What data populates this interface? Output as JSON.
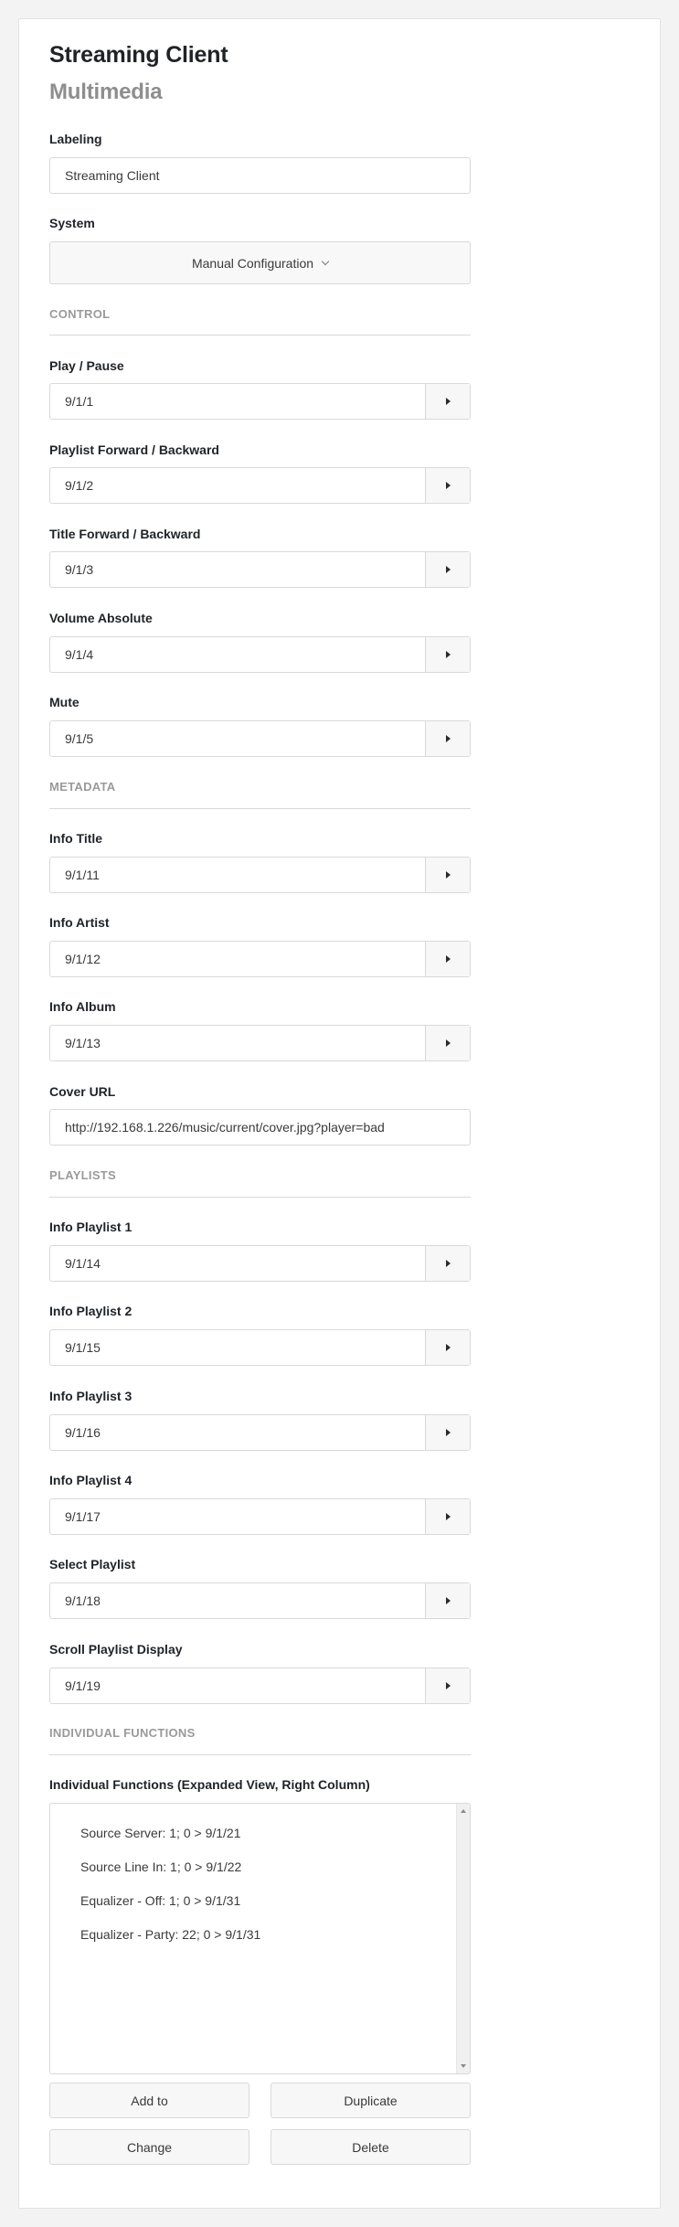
{
  "header": {
    "title": "Streaming Client",
    "subtitle": "Multimedia"
  },
  "labeling": {
    "label": "Labeling",
    "value": "Streaming Client"
  },
  "system": {
    "label": "System",
    "selected": "Manual Configuration"
  },
  "sections": {
    "control": "CONTROL",
    "metadata": "METADATA",
    "playlists": "PLAYLISTS",
    "individual": "INDIVIDUAL FUNCTIONS"
  },
  "control": [
    {
      "label": "Play / Pause",
      "value": "9/1/1"
    },
    {
      "label": "Playlist Forward / Backward",
      "value": "9/1/2"
    },
    {
      "label": "Title Forward / Backward",
      "value": "9/1/3"
    },
    {
      "label": "Volume Absolute",
      "value": "9/1/4"
    },
    {
      "label": "Mute",
      "value": "9/1/5"
    }
  ],
  "metadata": [
    {
      "label": "Info Title",
      "value": "9/1/11"
    },
    {
      "label": "Info Artist",
      "value": "9/1/12"
    },
    {
      "label": "Info Album",
      "value": "9/1/13"
    }
  ],
  "cover": {
    "label": "Cover URL",
    "value": "http://192.168.1.226/music/current/cover.jpg?player=bad"
  },
  "playlists": [
    {
      "label": "Info Playlist 1",
      "value": "9/1/14"
    },
    {
      "label": "Info Playlist 2",
      "value": "9/1/15"
    },
    {
      "label": "Info Playlist 3",
      "value": "9/1/16"
    },
    {
      "label": "Info Playlist 4",
      "value": "9/1/17"
    },
    {
      "label": "Select Playlist",
      "value": "9/1/18"
    },
    {
      "label": "Scroll Playlist Display",
      "value": "9/1/19"
    }
  ],
  "individual": {
    "label": "Individual Functions (Expanded View, Right Column)",
    "items": [
      "Source Server: 1; 0 > 9/1/21",
      "Source Line In: 1; 0 > 9/1/22",
      "Equalizer - Off: 1; 0 > 9/1/31",
      "Equalizer - Party: 22; 0 > 9/1/31"
    ]
  },
  "actions": {
    "add": "Add to",
    "duplicate": "Duplicate",
    "change": "Change",
    "delete": "Delete"
  },
  "icons": {
    "address_button": "play-triangle-icon",
    "select_arrow": "chevron-down-icon"
  }
}
